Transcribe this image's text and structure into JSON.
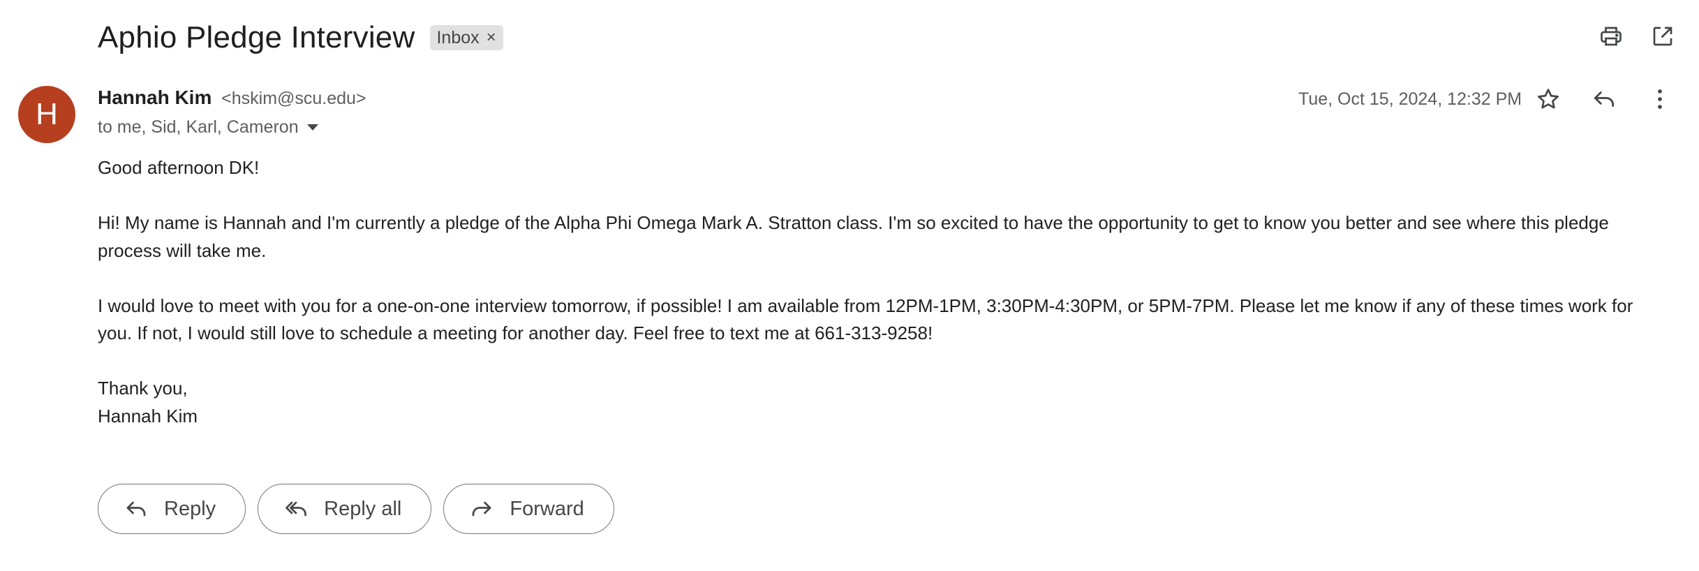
{
  "header": {
    "subject": "Aphio Pledge Interview",
    "label": "Inbox",
    "label_remove": "×",
    "print_icon": "print-icon",
    "open_new_window_icon": "open-in-new-icon"
  },
  "message": {
    "avatar_initial": "H",
    "avatar_color": "#b63f1f",
    "sender_name": "Hannah Kim",
    "sender_email": "<hskim@scu.edu>",
    "recipients": "to me, Sid, Karl, Cameron",
    "date": "Tue, Oct 15, 2024, 12:32 PM",
    "body": {
      "greeting": "Good afternoon DK!",
      "paragraph1": "Hi! My name is Hannah and I'm currently a pledge of the Alpha Phi Omega Mark A. Stratton class. I'm so excited to have the opportunity to get to know you better and see where this pledge process will take me.",
      "paragraph2": "I would love to meet with you for a one-on-one interview tomorrow, if possible! I am available from 12PM-1PM, 3:30PM-4:30PM, or 5PM-7PM. Please let me know if any of these times work for you. If not, I would still love to schedule a meeting for another day. Feel free to text me at 661-313-9258!",
      "closing": "Thank you,",
      "signature": "Hannah Kim"
    }
  },
  "actions": {
    "reply_label": "Reply",
    "reply_all_label": "Reply all",
    "forward_label": "Forward"
  }
}
